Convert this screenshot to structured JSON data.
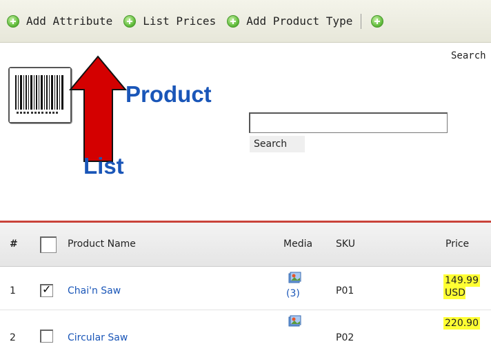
{
  "toolbar": {
    "items": [
      {
        "label": "Add Attribute",
        "icon": "add-icon"
      },
      {
        "label": "List Prices",
        "icon": "add-icon"
      },
      {
        "label": "Add Product Type",
        "icon": "add-icon"
      }
    ]
  },
  "search_link": "Search",
  "title_line1": "Product",
  "title_line2": "List",
  "search": {
    "value": "",
    "button_label": "Search"
  },
  "table": {
    "columns": [
      "#",
      "Product Name",
      "Media",
      "SKU",
      "Price"
    ],
    "rows": [
      {
        "num": "1",
        "checked": true,
        "name": "Chai'n Saw",
        "media_count": "(3)",
        "sku": "P01",
        "price_line1": "149.99",
        "price_line2": "USD"
      },
      {
        "num": "2",
        "checked": false,
        "name": "Circular Saw",
        "media_count": "",
        "sku": "P02",
        "price_line1": "220.90",
        "price_line2": ""
      }
    ]
  },
  "colors": {
    "link": "#1a56b8",
    "arrow": "#d40000",
    "price_highlight": "#ffff33",
    "rule": "#c9443a"
  }
}
